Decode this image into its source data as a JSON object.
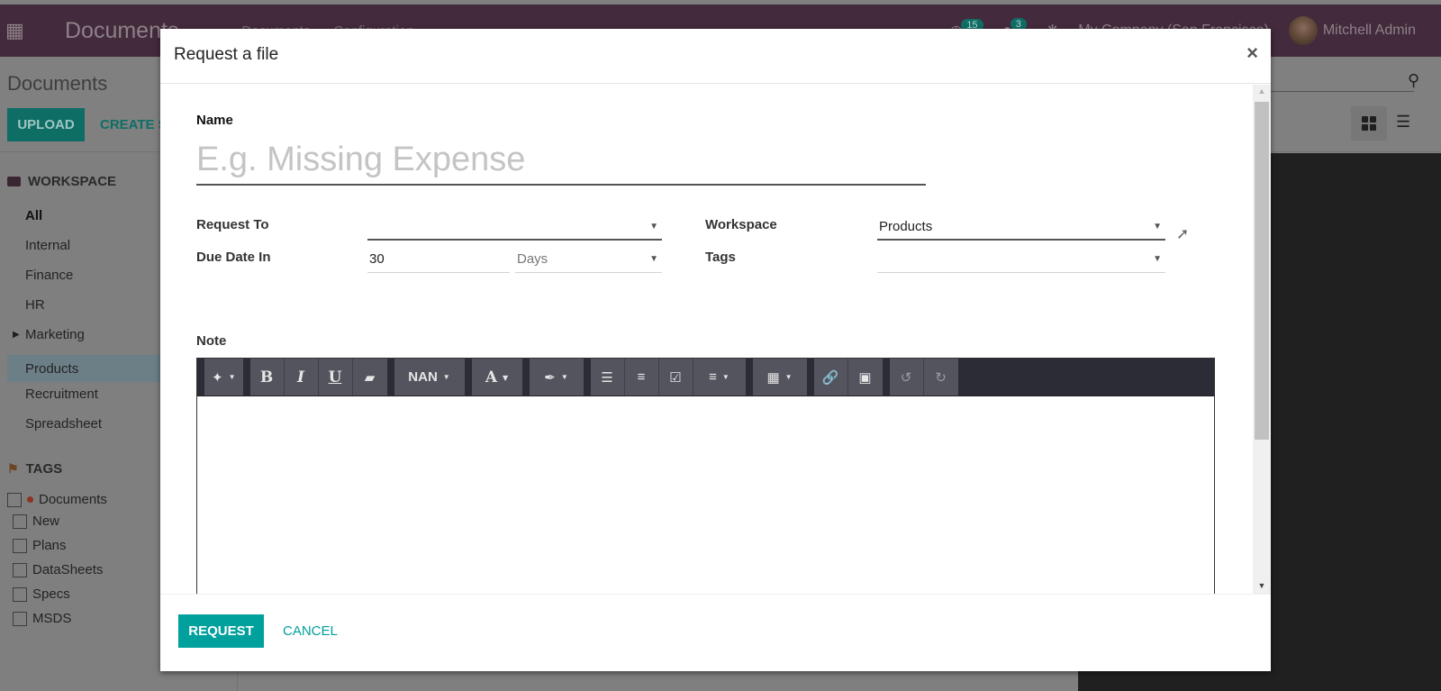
{
  "topbar": {
    "app_name": "Documents",
    "menu": [
      "Documents",
      "Configuration"
    ],
    "activity_count": "15",
    "message_count": "3",
    "company": "My Company (San Francisco)",
    "user": "Mitchell Admin"
  },
  "control_panel": {
    "breadcrumb": "Documents",
    "upload_label": "UPLOAD",
    "create_label": "CREATE S"
  },
  "sidebar": {
    "workspace_header": "WORKSPACE",
    "workspaces": [
      {
        "label": "All",
        "selected": false,
        "bold": true
      },
      {
        "label": "Internal"
      },
      {
        "label": "Finance"
      },
      {
        "label": "HR"
      },
      {
        "label": "Marketing",
        "expandable": true
      },
      {
        "label": "Products",
        "selected": true
      },
      {
        "label": "Recruitment"
      },
      {
        "label": "Spreadsheet"
      }
    ],
    "tags_header": "TAGS",
    "tag_category": {
      "label": "Documents",
      "color": "#8a3422"
    },
    "tags": [
      "New",
      "Plans",
      "DataSheets",
      "Specs",
      "MSDS"
    ]
  },
  "modal": {
    "title": "Request a file",
    "close_icon": "×",
    "name_label": "Name",
    "name_placeholder": "E.g. Missing Expense",
    "name_value": "",
    "request_to_label": "Request To",
    "request_to_value": "",
    "due_date_label": "Due Date In",
    "due_date_value": "30",
    "due_date_unit": "Days",
    "workspace_label": "Workspace",
    "workspace_value": "Products",
    "tags_label": "Tags",
    "tags_value": "",
    "note_label": "Note",
    "toolbar": {
      "style": "magic-wand",
      "bold": "B",
      "italic": "I",
      "underline": "U",
      "font_size": "NAN",
      "font_color": "A",
      "undo": "↺",
      "redo": "↻"
    },
    "request_button": "REQUEST",
    "cancel_button": "CANCEL"
  },
  "colors": {
    "primary": "#00a09d",
    "navbar": "#432a3c"
  }
}
